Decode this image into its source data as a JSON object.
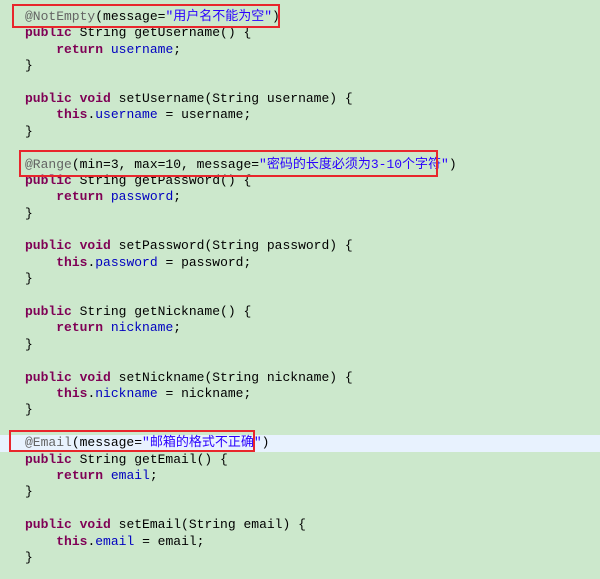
{
  "editor": {
    "background": "#cce8cc",
    "highlight_line_color": "#e8f2fe",
    "annotation_box_color": "#e8262c",
    "highlighted_line": 27,
    "lines": [
      [
        [
          "ann",
          "@NotEmpty"
        ],
        [
          "txt",
          "(message="
        ],
        [
          "str",
          "\"用户名不能为空\""
        ],
        [
          "txt",
          ")"
        ]
      ],
      [
        [
          "kw",
          "public"
        ],
        [
          "txt",
          " String getUsername() {"
        ]
      ],
      [
        [
          "txt",
          "    "
        ],
        [
          "kw",
          "return"
        ],
        [
          "txt",
          " "
        ],
        [
          "fld",
          "username"
        ],
        [
          "txt",
          ";"
        ]
      ],
      [
        [
          "txt",
          "}"
        ]
      ],
      [],
      [
        [
          "kw",
          "public"
        ],
        [
          "txt",
          " "
        ],
        [
          "kw",
          "void"
        ],
        [
          "txt",
          " setUsername(String username) {"
        ]
      ],
      [
        [
          "txt",
          "    "
        ],
        [
          "kw",
          "this"
        ],
        [
          "txt",
          "."
        ],
        [
          "fld",
          "username"
        ],
        [
          "txt",
          " = username;"
        ]
      ],
      [
        [
          "txt",
          "}"
        ]
      ],
      [],
      [
        [
          "ann",
          "@Range"
        ],
        [
          "txt",
          "(min=3, max=10, message="
        ],
        [
          "str",
          "\"密码的长度必须为3-10个字符\""
        ],
        [
          "txt",
          ")"
        ]
      ],
      [
        [
          "kw",
          "public"
        ],
        [
          "txt",
          " String getPassword() {"
        ]
      ],
      [
        [
          "txt",
          "    "
        ],
        [
          "kw",
          "return"
        ],
        [
          "txt",
          " "
        ],
        [
          "fld",
          "password"
        ],
        [
          "txt",
          ";"
        ]
      ],
      [
        [
          "txt",
          "}"
        ]
      ],
      [],
      [
        [
          "kw",
          "public"
        ],
        [
          "txt",
          " "
        ],
        [
          "kw",
          "void"
        ],
        [
          "txt",
          " setPassword(String password) {"
        ]
      ],
      [
        [
          "txt",
          "    "
        ],
        [
          "kw",
          "this"
        ],
        [
          "txt",
          "."
        ],
        [
          "fld",
          "password"
        ],
        [
          "txt",
          " = password;"
        ]
      ],
      [
        [
          "txt",
          "}"
        ]
      ],
      [],
      [
        [
          "kw",
          "public"
        ],
        [
          "txt",
          " String getNickname() {"
        ]
      ],
      [
        [
          "txt",
          "    "
        ],
        [
          "kw",
          "return"
        ],
        [
          "txt",
          " "
        ],
        [
          "fld",
          "nickname"
        ],
        [
          "txt",
          ";"
        ]
      ],
      [
        [
          "txt",
          "}"
        ]
      ],
      [],
      [
        [
          "kw",
          "public"
        ],
        [
          "txt",
          " "
        ],
        [
          "kw",
          "void"
        ],
        [
          "txt",
          " setNickname(String nickname) {"
        ]
      ],
      [
        [
          "txt",
          "    "
        ],
        [
          "kw",
          "this"
        ],
        [
          "txt",
          "."
        ],
        [
          "fld",
          "nickname"
        ],
        [
          "txt",
          " = nickname;"
        ]
      ],
      [
        [
          "txt",
          "}"
        ]
      ],
      [],
      [
        [
          "ann",
          "@Email"
        ],
        [
          "txt",
          "(message="
        ],
        [
          "str",
          "\"邮箱的格式不正确\""
        ],
        [
          "txt",
          ")"
        ]
      ],
      [
        [
          "kw",
          "public"
        ],
        [
          "txt",
          " String getEmail() {"
        ]
      ],
      [
        [
          "txt",
          "    "
        ],
        [
          "kw",
          "return"
        ],
        [
          "txt",
          " "
        ],
        [
          "fld",
          "email"
        ],
        [
          "txt",
          ";"
        ]
      ],
      [
        [
          "txt",
          "}"
        ]
      ],
      [],
      [
        [
          "kw",
          "public"
        ],
        [
          "txt",
          " "
        ],
        [
          "kw",
          "void"
        ],
        [
          "txt",
          " setEmail(String email) {"
        ]
      ],
      [
        [
          "txt",
          "    "
        ],
        [
          "kw",
          "this"
        ],
        [
          "txt",
          "."
        ],
        [
          "fld",
          "email"
        ],
        [
          "txt",
          " = email;"
        ]
      ],
      [
        [
          "txt",
          "}"
        ]
      ]
    ]
  }
}
